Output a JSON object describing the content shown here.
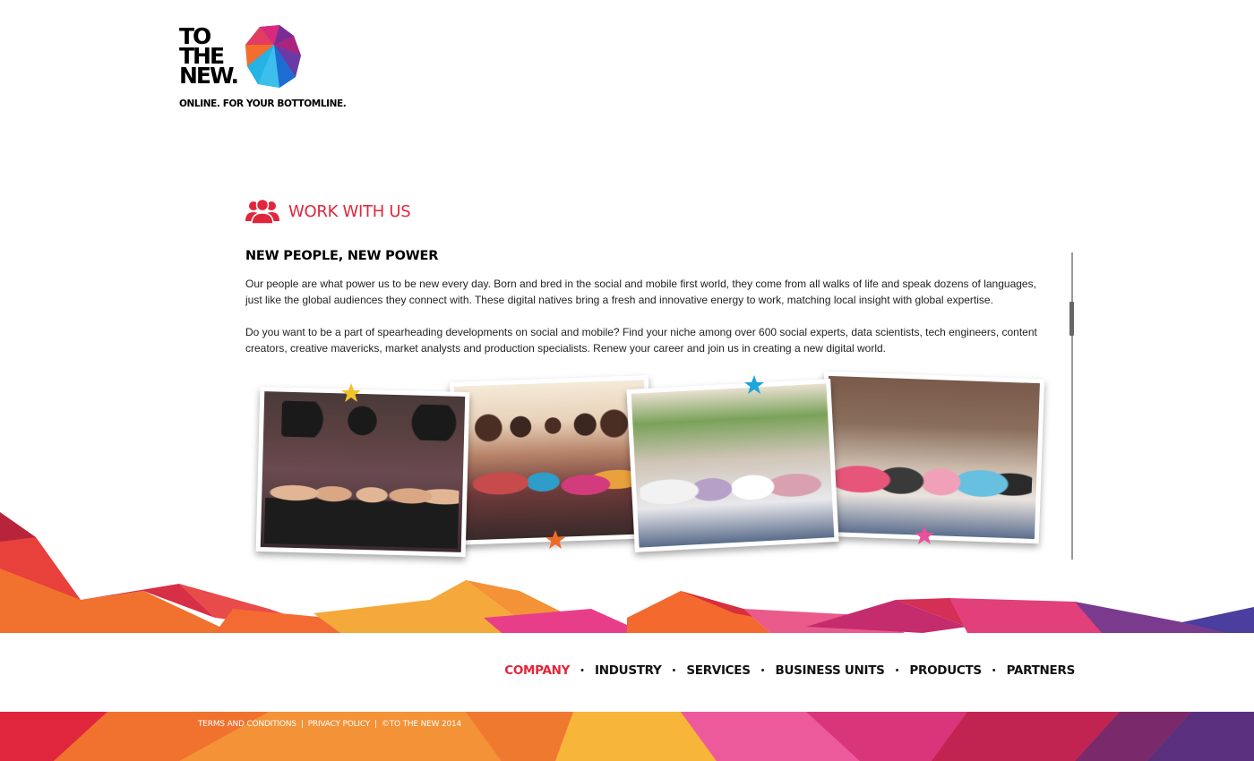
{
  "brand": {
    "line1": "TO",
    "line2": "THE",
    "line3": "NEW.",
    "tagline": "ONLINE. FOR YOUR BOTTOMLINE."
  },
  "section": {
    "title": "WORK WITH US",
    "icon": "people-icon",
    "accent_color": "#e0263c"
  },
  "content": {
    "subheading": "NEW PEOPLE, NEW POWER",
    "paragraph1": "Our people are what power us to be new every day. Born and bred in the social and mobile first world, they come from all walks of life and speak dozens of languages, just like the global audiences they connect with. These digital natives bring a fresh and innovative energy to work, matching local insight with global expertise.",
    "paragraph2": "Do you want to be a part of spearheading developments on social and mobile? Find your niche among over 600 social experts, data scientists, tech engineers, content creators, creative mavericks, market analysts and production specialists. Renew your career and join us in creating a new digital world."
  },
  "photos": {
    "items": [
      "team-photo",
      "team-photo",
      "team-photo",
      "team-photo"
    ],
    "star_colors": [
      "#f3c12d",
      "#ee6b26",
      "#1ea4de",
      "#ea4f9c"
    ]
  },
  "nav": {
    "items": [
      {
        "label": "COMPANY",
        "active": true
      },
      {
        "label": "INDUSTRY",
        "active": false
      },
      {
        "label": "SERVICES",
        "active": false
      },
      {
        "label": "BUSINESS UNITS",
        "active": false
      },
      {
        "label": "PRODUCTS",
        "active": false
      },
      {
        "label": "PARTNERS",
        "active": false
      }
    ],
    "separator": "•"
  },
  "footer": {
    "terms": "TERMS AND CONDITIONS",
    "privacy": "PRIVACY POLICY",
    "copyright": "©TO THE NEW 2014",
    "divider": "|"
  }
}
